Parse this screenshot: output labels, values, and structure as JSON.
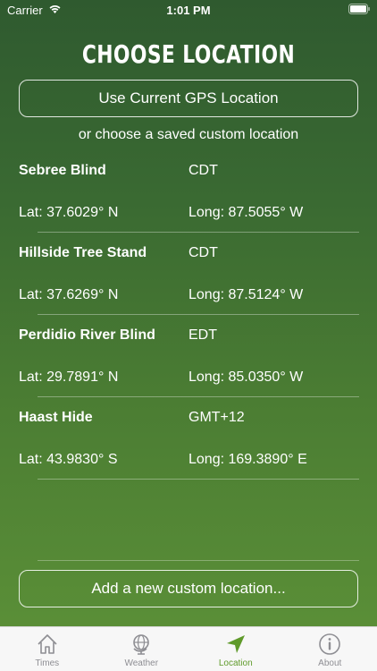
{
  "status": {
    "carrier": "Carrier",
    "time": "1:01 PM"
  },
  "page": {
    "title": "CHOOSE LOCATION",
    "gps_button": "Use Current GPS Location",
    "subtitle": "or choose a saved custom location",
    "add_button": "Add a new custom location..."
  },
  "locations": [
    {
      "name": "Sebree Blind",
      "tz": "CDT",
      "lat": "Lat: 37.6029° N",
      "long": "Long: 87.5055° W"
    },
    {
      "name": "Hillside Tree Stand",
      "tz": "CDT",
      "lat": "Lat: 37.6269° N",
      "long": "Long: 87.5124° W"
    },
    {
      "name": "Perdidio River Blind",
      "tz": "EDT",
      "lat": "Lat: 29.7891° N",
      "long": "Long: 85.0350° W"
    },
    {
      "name": "Haast Hide",
      "tz": "GMT+12",
      "lat": "Lat: 43.9830° S",
      "long": "Long: 169.3890° E"
    }
  ],
  "tabs": [
    {
      "label": "Times",
      "icon": "house-icon"
    },
    {
      "label": "Weather",
      "icon": "globe-icon"
    },
    {
      "label": "Location",
      "icon": "location-arrow-icon",
      "active": true
    },
    {
      "label": "About",
      "icon": "info-icon"
    }
  ],
  "colors": {
    "accent": "#5f9a2a",
    "bg_top": "#2f5a2f",
    "bg_bottom": "#5d9238"
  }
}
